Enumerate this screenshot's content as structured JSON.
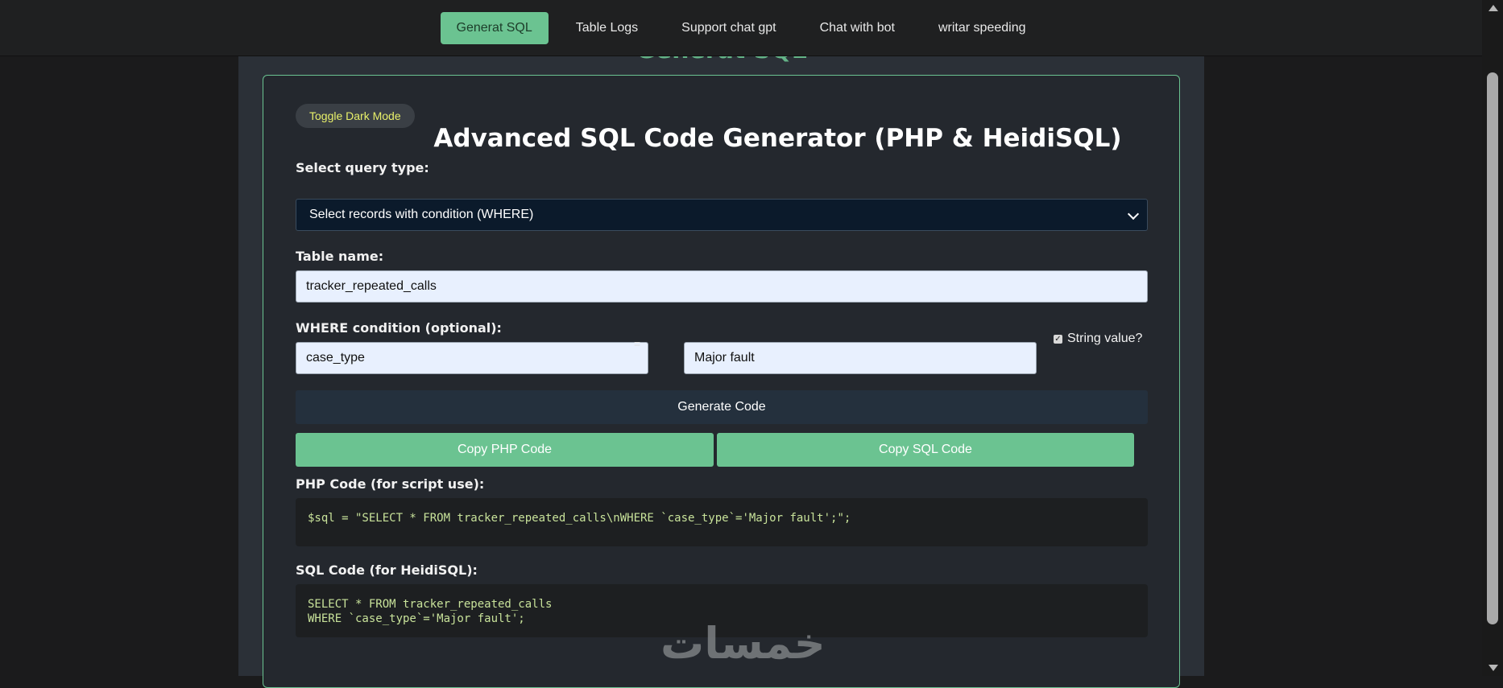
{
  "nav": {
    "items": [
      "Generat SQL",
      "Table Logs",
      "Support chat gpt",
      "Chat with bot",
      "writar speeding"
    ],
    "active_index": 0
  },
  "page": {
    "ghost_title": "Generat SQL",
    "toggle_label": "Toggle Dark Mode",
    "heading": "Advanced SQL Code Generator (PHP & HeidiSQL)"
  },
  "form": {
    "query_type_label": "Select query type:",
    "query_type_value": "Select records with condition (WHERE)",
    "table_label": "Table name:",
    "table_value": "tracker_repeated_calls",
    "where_label": "WHERE condition (optional):",
    "where_column": "case_type",
    "equals_sign": "=",
    "where_value": "Major fault",
    "string_value_label": "String value?",
    "string_value_checked": true
  },
  "buttons": {
    "generate": "Generate Code",
    "copy_php": "Copy PHP Code",
    "copy_sql": "Copy SQL Code"
  },
  "output": {
    "php_label": "PHP Code (for script use):",
    "php_code": "$sql = \"SELECT * FROM tracker_repeated_calls\\nWHERE `case_type`='Major fault';\";",
    "sql_label": "SQL Code (for HeidiSQL):",
    "sql_code": "SELECT * FROM tracker_repeated_calls\nWHERE `case_type`='Major fault';"
  },
  "watermark": "خمسات",
  "colors": {
    "accent": "#6bc391",
    "page_bg": "#1b1b1c",
    "card_bg": "#24282e",
    "code_text": "#c8e29a",
    "toggle_text": "#e8f06a"
  }
}
